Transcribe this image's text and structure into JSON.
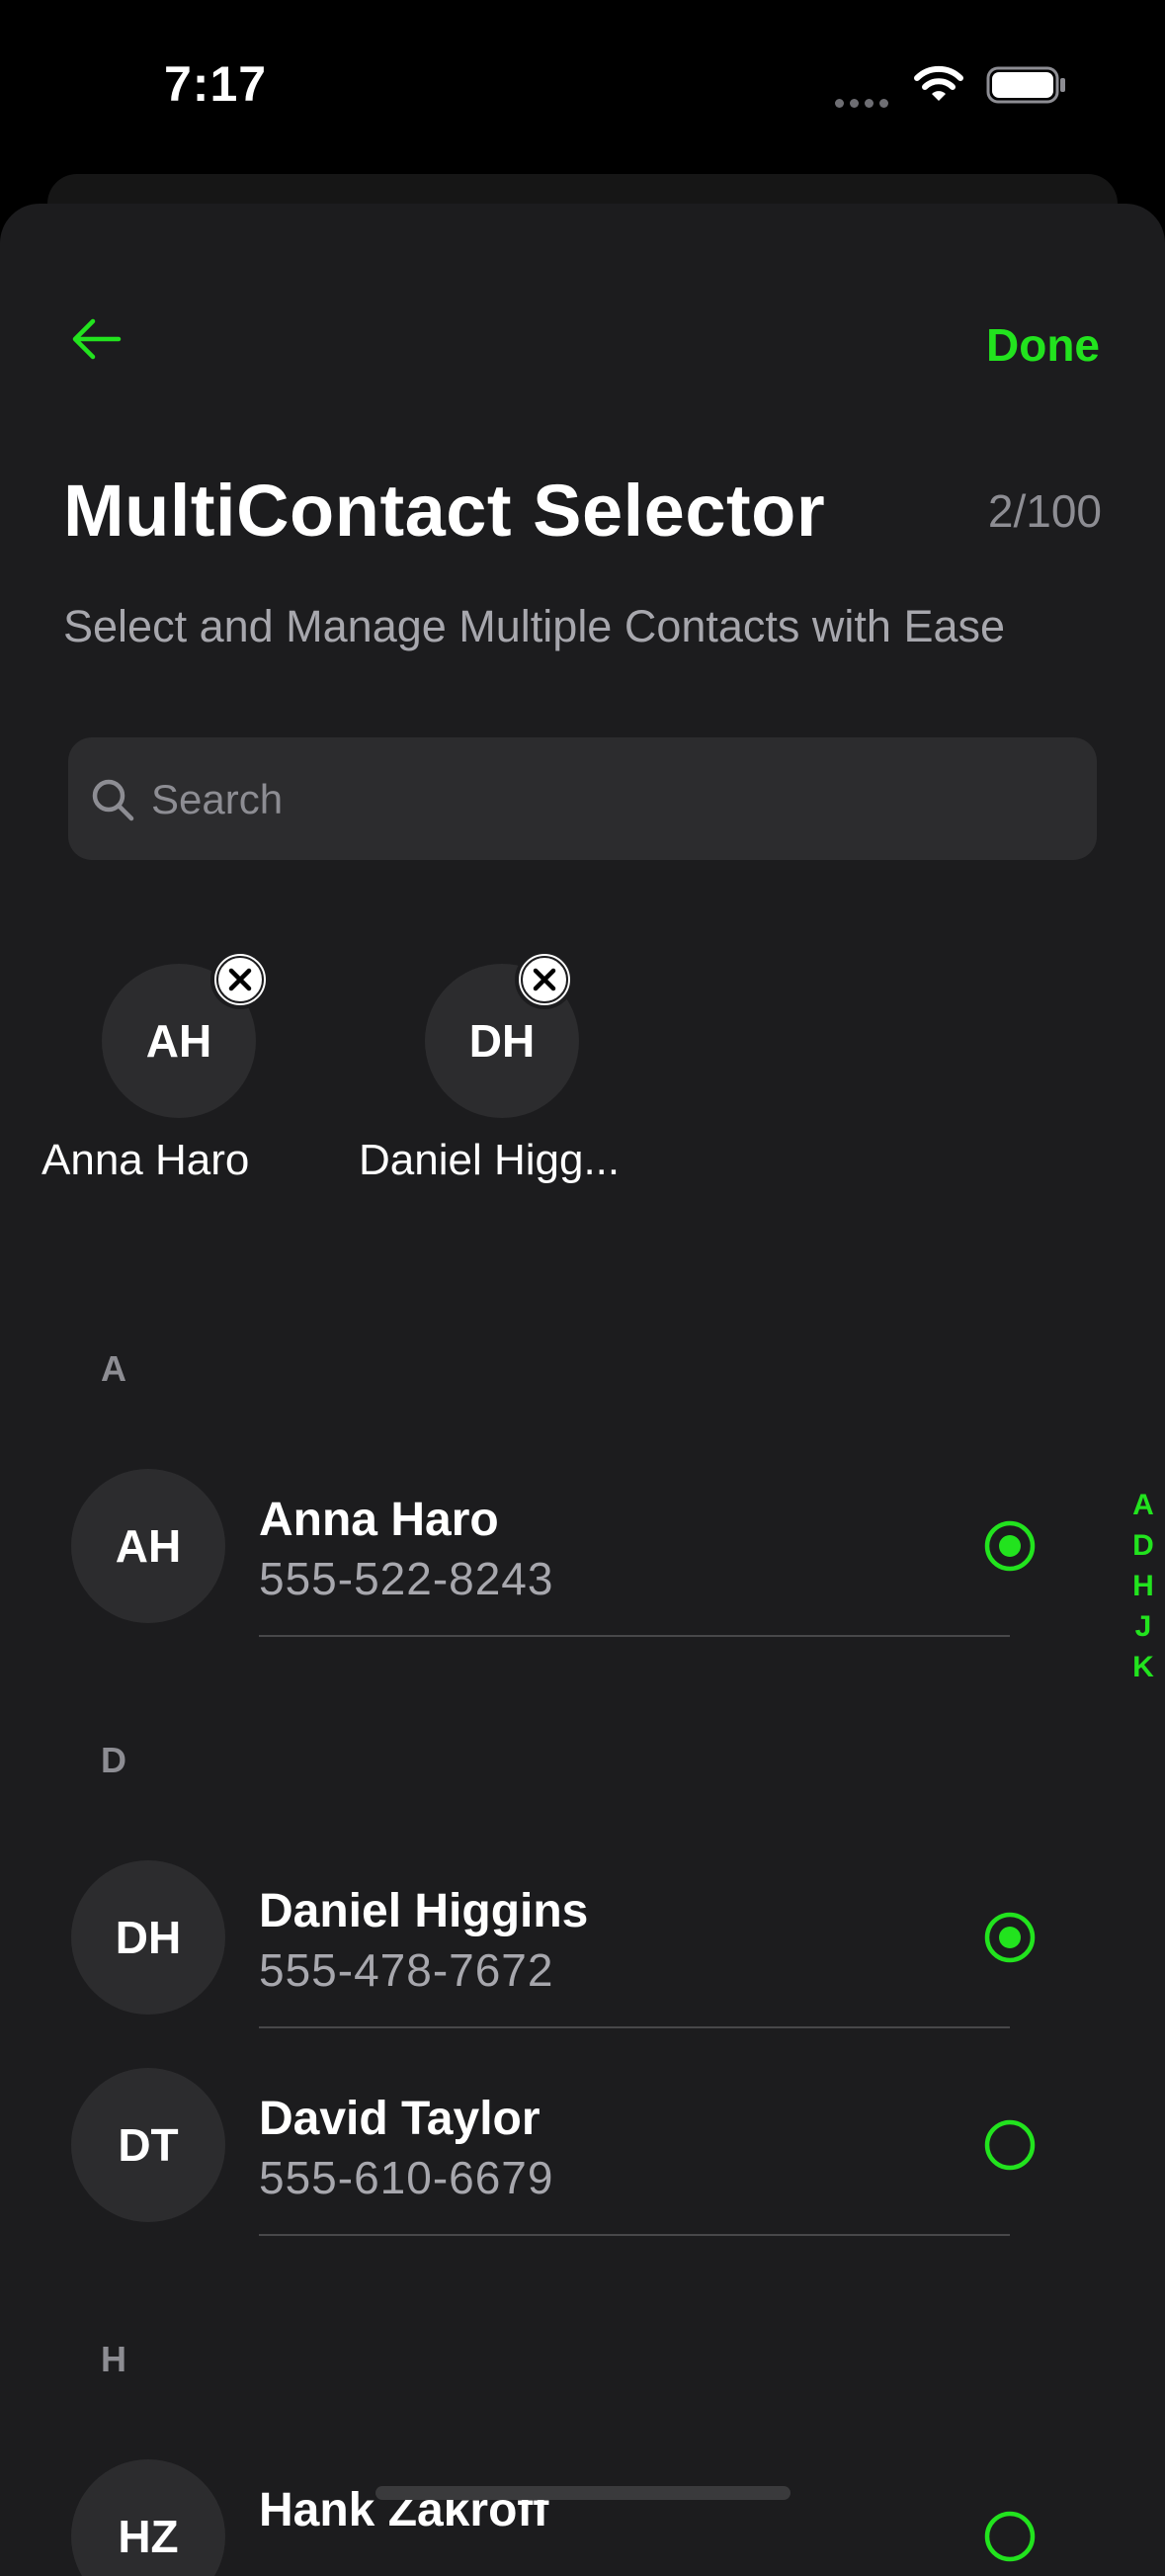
{
  "status_bar": {
    "time": "7:17"
  },
  "header": {
    "done_label": "Done",
    "title": "MultiContact Selector",
    "count": "2/100",
    "subtitle": "Select and Manage Multiple Contacts with Ease"
  },
  "search": {
    "placeholder": "Search"
  },
  "selected_chips": [
    {
      "initials": "AH",
      "name": "Anna Haro"
    },
    {
      "initials": "DH",
      "name": "Daniel Higg..."
    }
  ],
  "sections": [
    {
      "letter": "A",
      "contacts": [
        {
          "initials": "AH",
          "name": "Anna Haro",
          "phone": "555-522-8243",
          "selected": true
        }
      ]
    },
    {
      "letter": "D",
      "contacts": [
        {
          "initials": "DH",
          "name": "Daniel Higgins",
          "phone": "555-478-7672",
          "selected": true
        },
        {
          "initials": "DT",
          "name": "David Taylor",
          "phone": "555-610-6679",
          "selected": false
        }
      ]
    },
    {
      "letter": "H",
      "contacts": [
        {
          "initials": "HZ",
          "name": "Hank Zakroff",
          "phone": "",
          "selected": false
        }
      ]
    }
  ],
  "index_letters": [
    "A",
    "D",
    "H",
    "J",
    "K"
  ],
  "colors": {
    "accent": "#22e31e",
    "background": "#1c1c1e",
    "avatar": "#2c2c2e",
    "secondary_text": "#a7a7ad"
  }
}
